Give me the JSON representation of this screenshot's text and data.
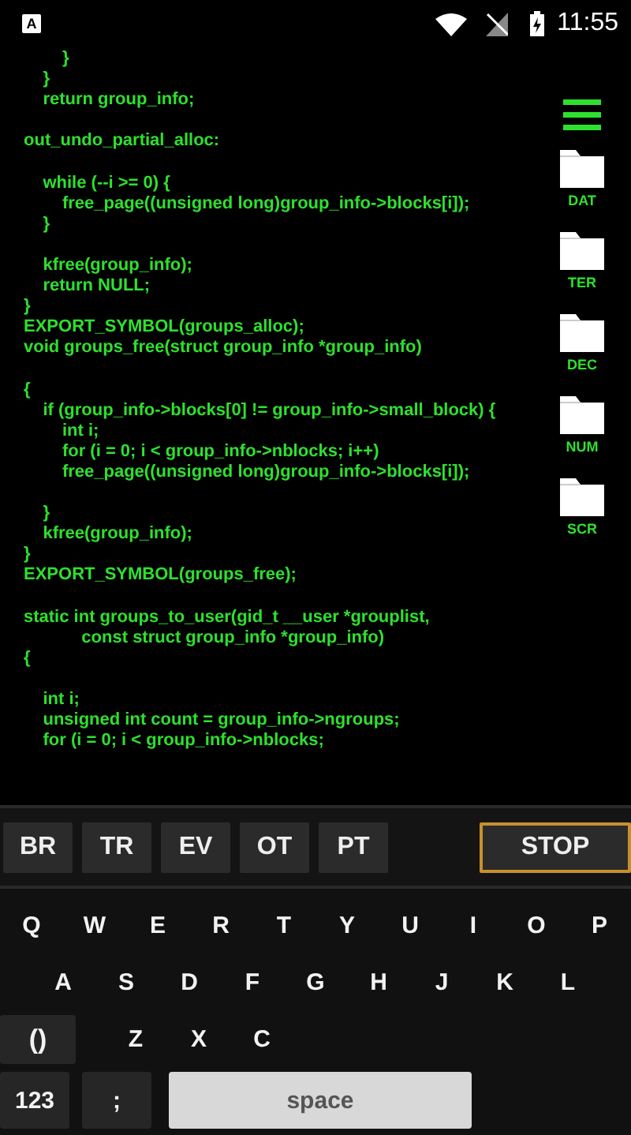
{
  "status_bar": {
    "notification": "A",
    "time": "11:55"
  },
  "code": {
    "blocks": [
      [
        "        }",
        "    }",
        "    return group_info;"
      ],
      [
        "out_undo_partial_alloc:"
      ],
      [
        "    while (--i >= 0) {",
        "        free_page((unsigned long)group_info->blocks[i]);",
        "    }"
      ],
      [
        "    kfree(group_info);",
        "    return NULL;",
        "}",
        "EXPORT_SYMBOL(groups_alloc);",
        "void groups_free(struct group_info *group_info)"
      ],
      [
        "{",
        "    if (group_info->blocks[0] != group_info->small_block) {",
        "        int i;",
        "        for (i = 0; i < group_info->nblocks; i++)",
        "        free_page((unsigned long)group_info->blocks[i]);"
      ],
      [
        "    }",
        "    kfree(group_info);",
        "}",
        "EXPORT_SYMBOL(groups_free);"
      ],
      [
        "static int groups_to_user(gid_t __user *grouplist,",
        "            const struct group_info *group_info)",
        "{"
      ],
      [
        "    int i;",
        "    unsigned int count = group_info->ngroups;",
        "    for (i = 0; i < group_info->nblocks;"
      ]
    ]
  },
  "side_panel": {
    "folders": [
      {
        "label": "DAT"
      },
      {
        "label": "TER"
      },
      {
        "label": "DEC"
      },
      {
        "label": "NUM"
      },
      {
        "label": "SCR"
      }
    ]
  },
  "commands": [
    {
      "label": "BR",
      "selected": false
    },
    {
      "label": "TR",
      "selected": false
    },
    {
      "label": "EV",
      "selected": false
    },
    {
      "label": "OT",
      "selected": false
    },
    {
      "label": "PT",
      "selected": false
    },
    {
      "label": "STOP",
      "selected": true
    }
  ],
  "keyboard": {
    "rows": [
      {
        "keys": [
          {
            "label": "Q",
            "kind": "letter"
          },
          {
            "label": "W",
            "kind": "letter"
          },
          {
            "label": "E",
            "kind": "letter"
          },
          {
            "label": "R",
            "kind": "letter"
          },
          {
            "label": "T",
            "kind": "letter"
          },
          {
            "label": "Y",
            "kind": "letter"
          },
          {
            "label": "U",
            "kind": "letter"
          },
          {
            "label": "I",
            "kind": "letter"
          },
          {
            "label": "O",
            "kind": "letter"
          },
          {
            "label": "P",
            "kind": "letter"
          }
        ]
      },
      {
        "keys": [
          {
            "label": "A",
            "kind": "letter"
          },
          {
            "label": "S",
            "kind": "letter"
          },
          {
            "label": "D",
            "kind": "letter"
          },
          {
            "label": "F",
            "kind": "letter"
          },
          {
            "label": "G",
            "kind": "letter"
          },
          {
            "label": "H",
            "kind": "letter"
          },
          {
            "label": "J",
            "kind": "letter"
          },
          {
            "label": "K",
            "kind": "letter"
          },
          {
            "label": "L",
            "kind": "letter"
          }
        ]
      },
      {
        "keys": [
          {
            "label": "()",
            "kind": "function"
          },
          {
            "label": "Z",
            "kind": "letter"
          },
          {
            "label": "X",
            "kind": "letter"
          },
          {
            "label": "C",
            "kind": "letter"
          }
        ]
      },
      {
        "keys": [
          {
            "label": "123",
            "kind": "function"
          },
          {
            "label": ";",
            "kind": "function"
          },
          {
            "label": "space",
            "kind": "space"
          }
        ]
      }
    ]
  }
}
